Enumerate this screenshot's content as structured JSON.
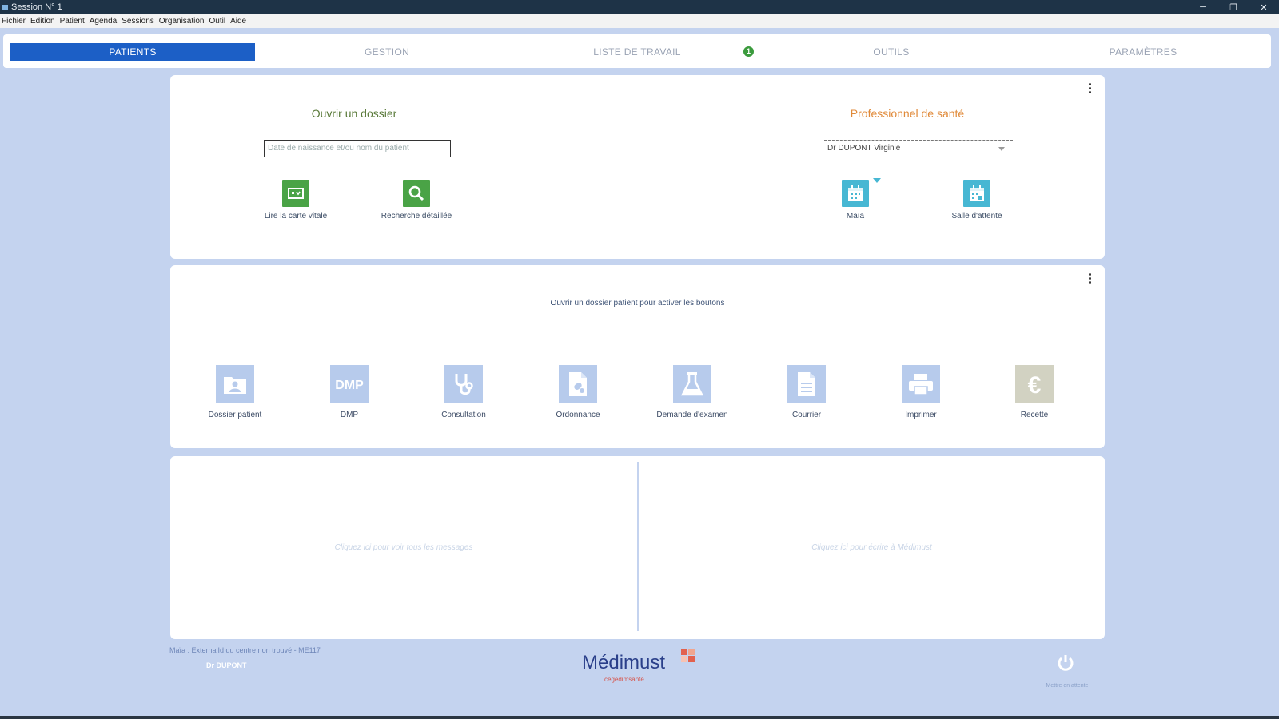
{
  "window": {
    "title": "Session N° 1",
    "minimize": "─",
    "restore": "❐",
    "close": "✕"
  },
  "menu": [
    "Fichier",
    "Edition",
    "Patient",
    "Agenda",
    "Sessions",
    "Organisation",
    "Outil",
    "Aide"
  ],
  "tabs": [
    {
      "label": "PATIENTS",
      "active": true
    },
    {
      "label": "GESTION"
    },
    {
      "label": "LISTE DE TRAVAIL",
      "badge": "1"
    },
    {
      "label": "OUTILS"
    },
    {
      "label": "PARAMÈTRES"
    }
  ],
  "open_record": {
    "title": "Ouvrir un dossier",
    "title_color": "#5a7a3a",
    "search_placeholder": "Date de naissance et/ou nom du patient",
    "actions": [
      {
        "label": "Lire la carte vitale",
        "icon": "vitale-card-icon"
      },
      {
        "label": "Recherche détaillée",
        "icon": "search-icon"
      }
    ]
  },
  "health_pro": {
    "title": "Professionnel de santé",
    "title_color": "#e08a3a",
    "selected": "Dr DUPONT Virginie",
    "actions": [
      {
        "label": "Maïa",
        "icon": "calendar-icon"
      },
      {
        "label": "Salle d'attente",
        "icon": "calendar-icon"
      }
    ]
  },
  "patient_actions": {
    "hint": "Ouvrir un dossier patient pour activer les boutons",
    "buttons": [
      {
        "label": "Dossier patient",
        "icon": "patient-folder-icon"
      },
      {
        "label": "DMP",
        "icon": "dmp-icon"
      },
      {
        "label": "Consultation",
        "icon": "stethoscope-icon"
      },
      {
        "label": "Ordonnance",
        "icon": "prescription-icon"
      },
      {
        "label": "Demande d'examen",
        "icon": "flask-icon"
      },
      {
        "label": "Courrier",
        "icon": "document-icon"
      },
      {
        "label": "Imprimer",
        "icon": "printer-icon"
      },
      {
        "label": "Recette",
        "icon": "euro-icon"
      }
    ]
  },
  "messages": {
    "left": "Cliquez ici pour voir tous les messages",
    "right": "Cliquez ici pour écrire à Médimust"
  },
  "footer": {
    "status": "Maïa : ExternalId du centre non trouvé - ME117",
    "user": "Dr DUPONT",
    "logo": "Médimust",
    "logo_sub": "cegedimsanté",
    "power_label": "Mettre en attente"
  }
}
